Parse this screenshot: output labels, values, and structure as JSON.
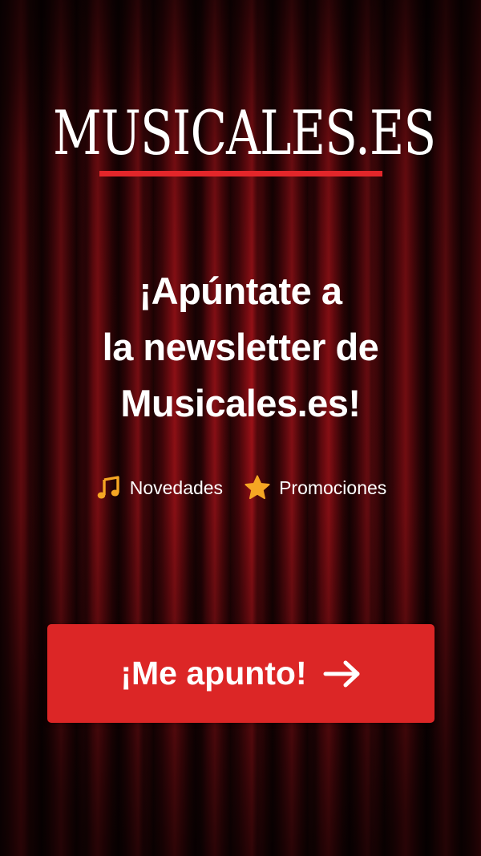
{
  "brand": {
    "logo_text": "MUSICALES.ES"
  },
  "headline": {
    "line1": "¡Apúntate a",
    "line2": "la newsletter de",
    "line3": "Musicales.es!"
  },
  "features": [
    {
      "label": "Novedades",
      "icon": "music-note-icon"
    },
    {
      "label": "Promociones",
      "icon": "star-icon"
    }
  ],
  "cta": {
    "label": "¡Me apunto!",
    "icon": "arrow-right-icon"
  },
  "colors": {
    "accent": "#dc2626",
    "icon_gold": "#f5a623",
    "text": "#ffffff"
  }
}
